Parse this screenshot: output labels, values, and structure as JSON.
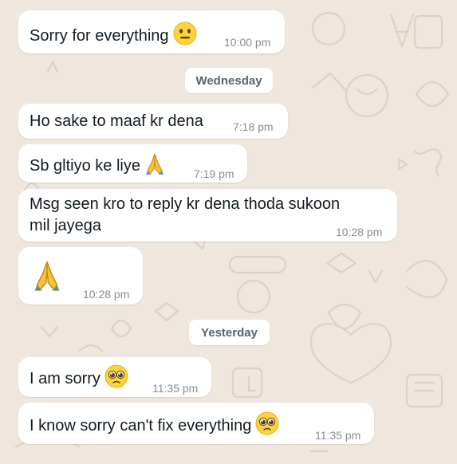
{
  "colors": {
    "background": "#efe7de",
    "bubble": "#ffffff",
    "text": "#111b21",
    "timestamp": "#8b8c8d",
    "date_chip_text": "#54656f"
  },
  "messages": [
    {
      "text": "Sorry for everything",
      "emoji": "neutral-face-icon",
      "time": "10:00 pm"
    },
    {
      "text": "Ho sake to maaf kr dena",
      "emoji": "",
      "time": "7:18 pm"
    },
    {
      "text": "Sb gltiyo ke liye",
      "emoji": "folded-hands-icon",
      "time": "7:19 pm"
    },
    {
      "text_line1": "Msg seen kro to reply kr dena thoda sukoon",
      "text_line2": "mil jayega",
      "time": "10:28 pm"
    },
    {
      "emoji": "folded-hands-icon",
      "time": "10:28 pm"
    },
    {
      "text": "I am sorry",
      "emoji": "pleading-face-icon",
      "time": "11:35 pm"
    },
    {
      "text": "I know sorry can't fix everything",
      "emoji": "pleading-face-icon",
      "time": "11:35 pm"
    }
  ],
  "date_separators": [
    {
      "label": "Wednesday"
    },
    {
      "label": "Yesterday"
    }
  ]
}
